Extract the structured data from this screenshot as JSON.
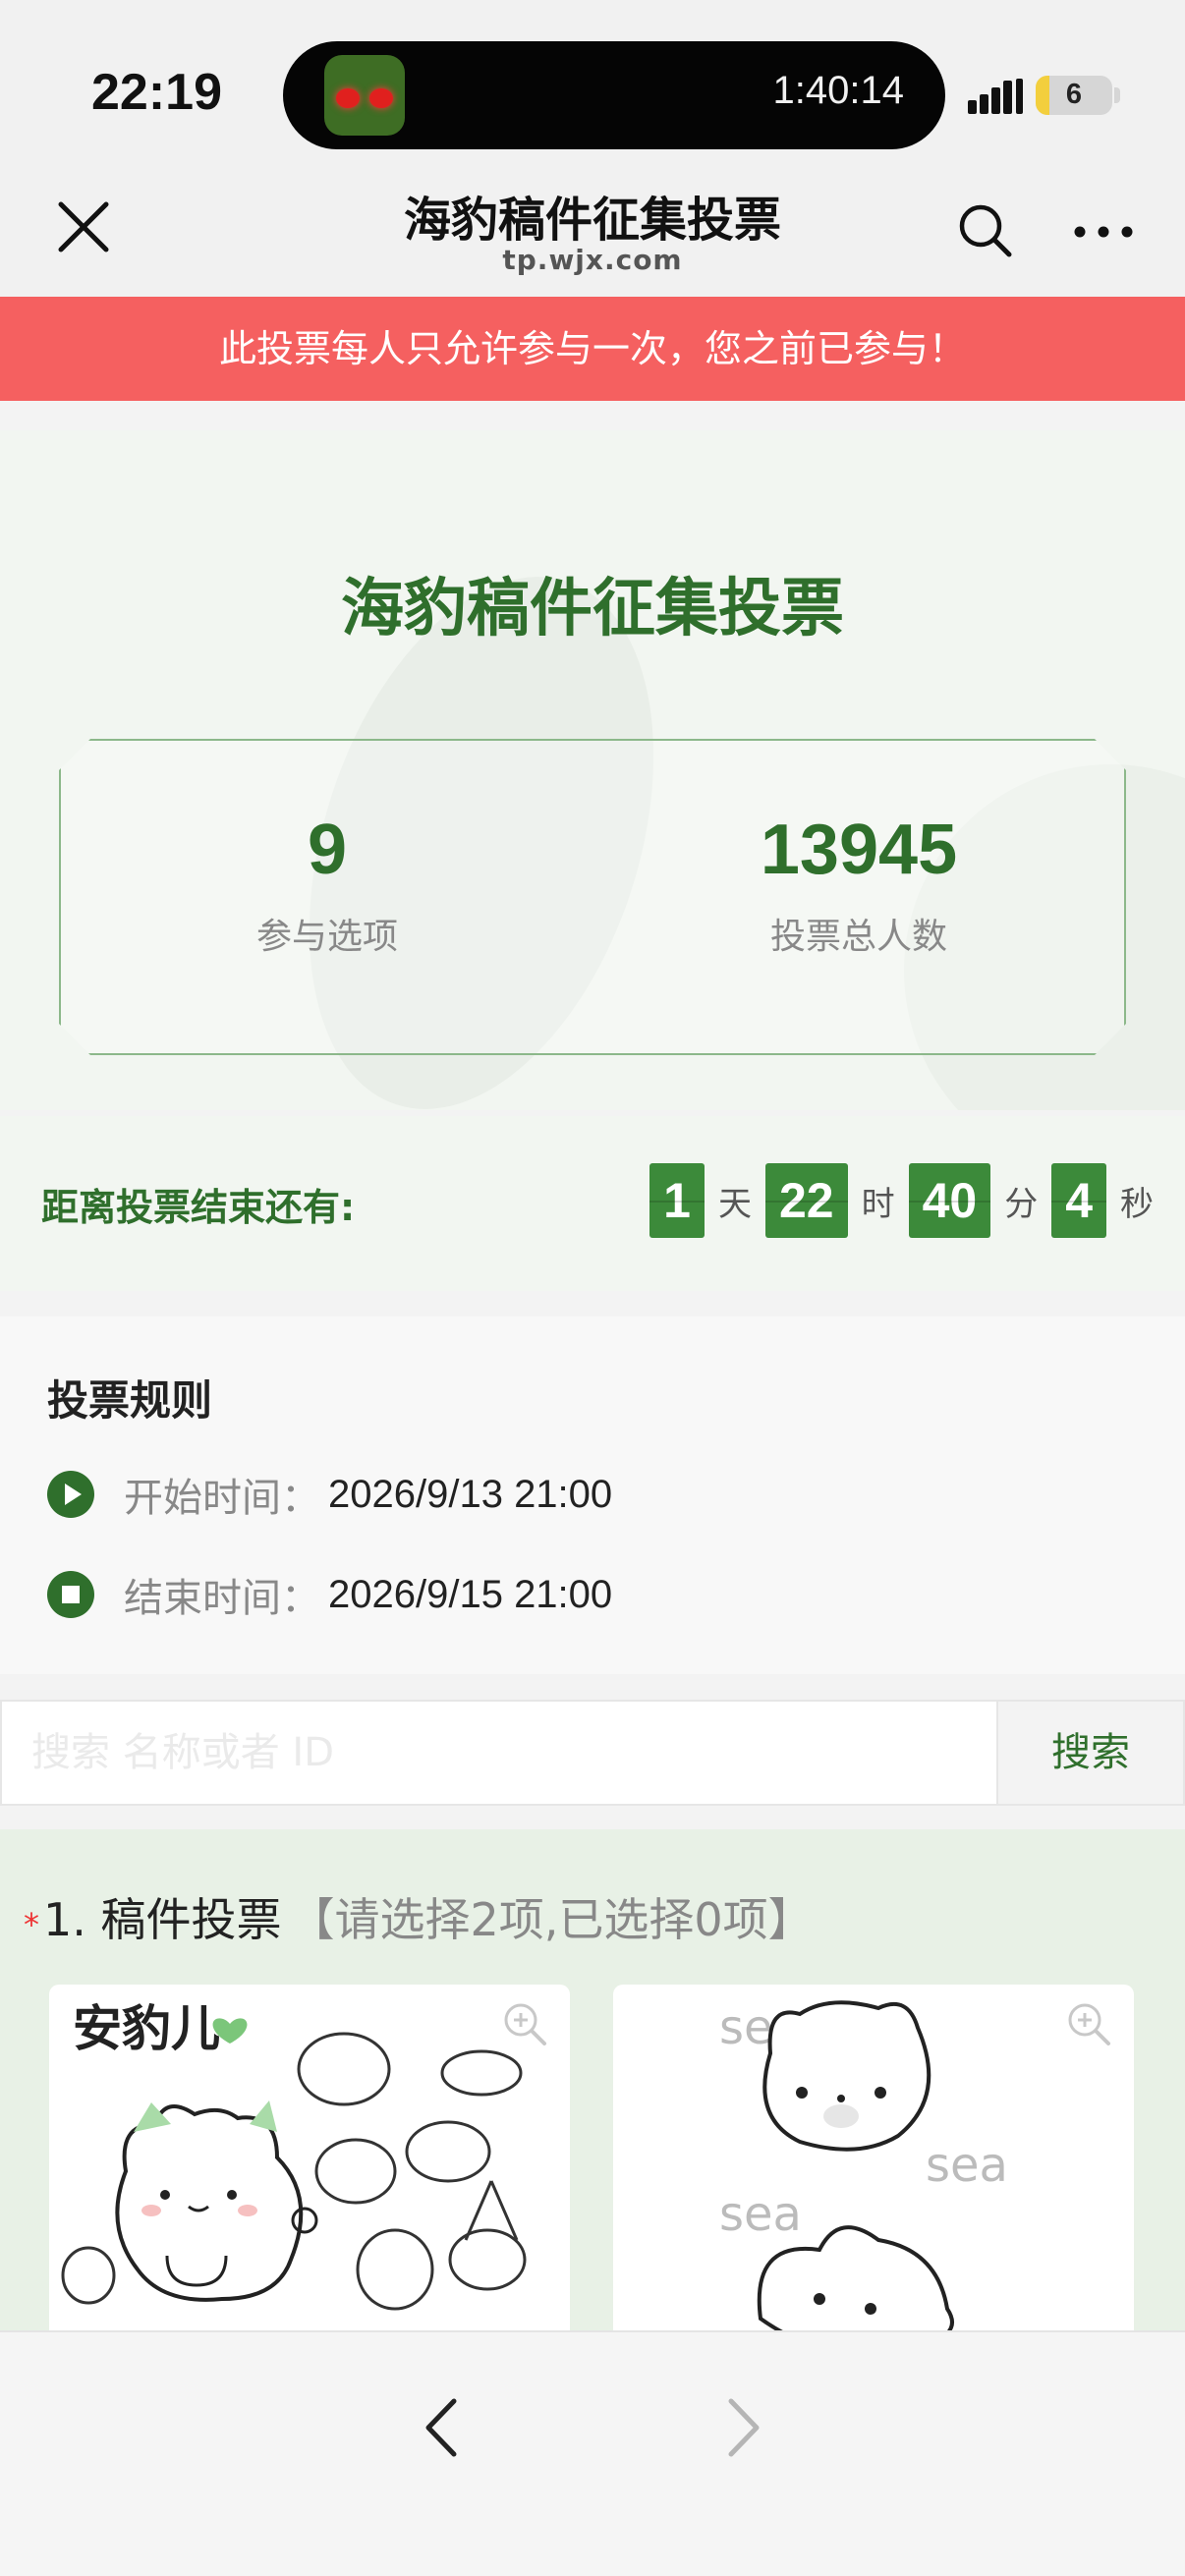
{
  "status_bar": {
    "time": "22:19",
    "activity_timer": "1:40:14",
    "battery": "6"
  },
  "nav": {
    "title": "海豹稿件征集投票",
    "url": "tp.wjx.com"
  },
  "alert": {
    "text": "此投票每人只允许参与一次，您之前已参与！"
  },
  "survey": {
    "title": "海豹稿件征集投票",
    "stats": [
      {
        "value": "9",
        "label": "参与选项"
      },
      {
        "value": "13945",
        "label": "投票总人数"
      }
    ]
  },
  "countdown": {
    "label": "距离投票结束还有:",
    "days": "1",
    "days_unit": "天",
    "hours": "22",
    "hours_unit": "时",
    "minutes": "40",
    "minutes_unit": "分",
    "seconds": "4",
    "seconds_unit": "秒"
  },
  "rules": {
    "title": "投票规则",
    "start_label": "开始时间：",
    "start_value": "2026/9/13 21:00",
    "end_label": "结束时间：",
    "end_value": "2026/9/15 21:00"
  },
  "search": {
    "placeholder": "搜索 名称或者 ID",
    "button": "搜索"
  },
  "question": {
    "required_mark": "*",
    "title": "1. 稿件投票",
    "hint": "【请选择2项,已选择0项】",
    "card1_heading": "安豹儿",
    "card2_words": [
      "sea",
      "sea",
      "sea"
    ]
  },
  "icons": {
    "close": "close-icon",
    "search": "search-icon",
    "more": "more-icon",
    "zoom": "zoom-icon",
    "back": "chevron-left-icon",
    "forward": "chevron-right-icon"
  },
  "colors": {
    "brand_green": "#2f6f2c",
    "countdown_green": "#3c8a3a",
    "alert_red": "#f56060"
  }
}
